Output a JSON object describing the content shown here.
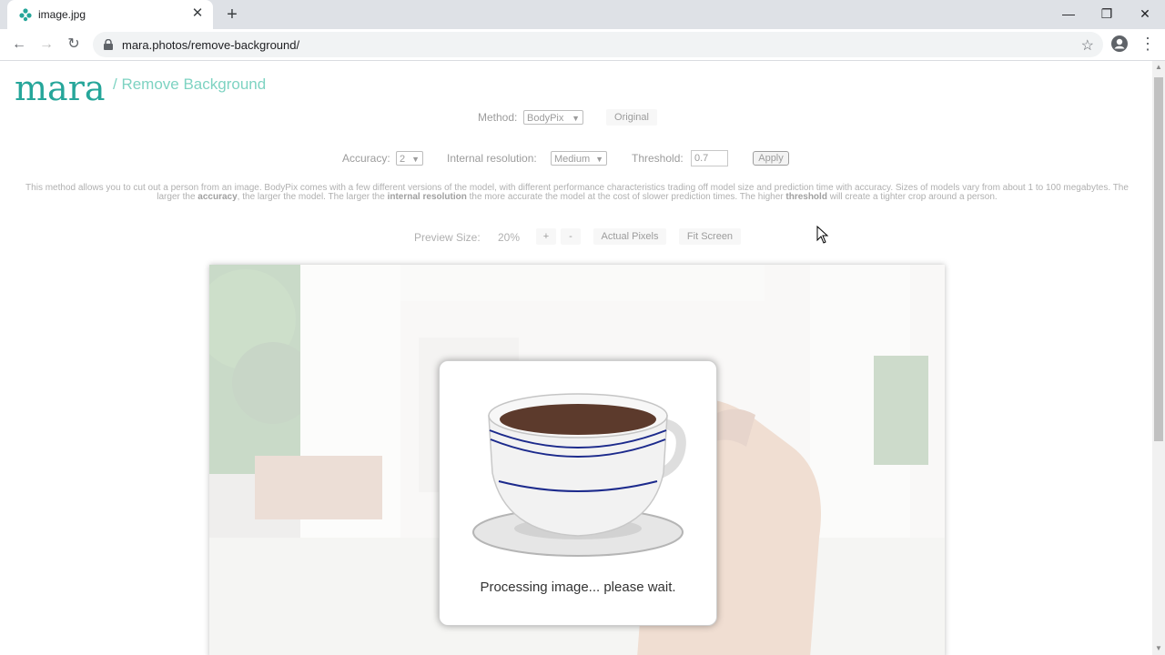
{
  "browser": {
    "tab_title": "image.jpg",
    "url": "mara.photos/remove-background/",
    "window_controls": [
      "minimize-icon",
      "restore-icon",
      "close-icon"
    ]
  },
  "header": {
    "logo_text": "mara",
    "subtitle": "/ Remove Background"
  },
  "controls": {
    "method_label": "Method:",
    "method_value": "BodyPix",
    "original_button": "Original",
    "accuracy_label": "Accuracy:",
    "accuracy_value": "2",
    "resolution_label": "Internal resolution:",
    "resolution_value": "Medium",
    "threshold_label": "Threshold:",
    "threshold_value": "0.7",
    "apply_button": "Apply"
  },
  "description": {
    "part1": "This method allows you to cut out a person from an image. BodyPix comes with a few different versions of the model, with different performance characteristics trading off model size and prediction time with accuracy. Sizes of models vary from about 1 to 100 megabytes. The larger the ",
    "bold1": "accuracy",
    "part2": ", the larger the model. The larger the ",
    "bold2": "internal resolution",
    "part3": " the more accurate the model at the cost of slower prediction times. The higher ",
    "bold3": "threshold",
    "part4": " will create a tighter crop around a person."
  },
  "preview": {
    "size_label": "Preview Size:",
    "size_value": "20%",
    "plus_button": "+",
    "minus_button": "-",
    "actual_pixels_button": "Actual Pixels",
    "fit_screen_button": "Fit Screen"
  },
  "dialog": {
    "message": "Processing image... please wait.",
    "icon": "coffee-cup-icon"
  },
  "colors": {
    "brand": "#26a69a",
    "brand_light": "#7ed3c2"
  }
}
